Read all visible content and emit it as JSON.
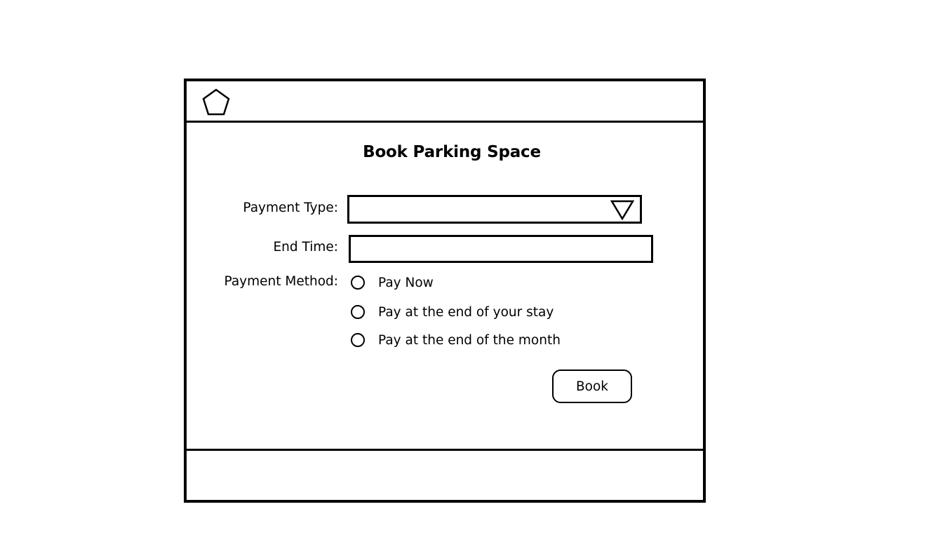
{
  "header": {
    "logo_icon": "pentagon-icon"
  },
  "form": {
    "title": "Book Parking Space",
    "payment_type": {
      "label": "Payment Type:",
      "value": "",
      "arrow_icon": "triangle-down-icon"
    },
    "end_time": {
      "label": "End Time:",
      "value": "",
      "placeholder": ""
    },
    "payment_method": {
      "label": "Payment Method:",
      "options": [
        {
          "label": "Pay Now",
          "selected": false
        },
        {
          "label": "Pay at the end of your stay",
          "selected": false
        },
        {
          "label": "Pay at the end of the month",
          "selected": false
        }
      ]
    },
    "book_button_label": "Book"
  },
  "colors": {
    "stroke": "#000000",
    "background": "#ffffff"
  }
}
